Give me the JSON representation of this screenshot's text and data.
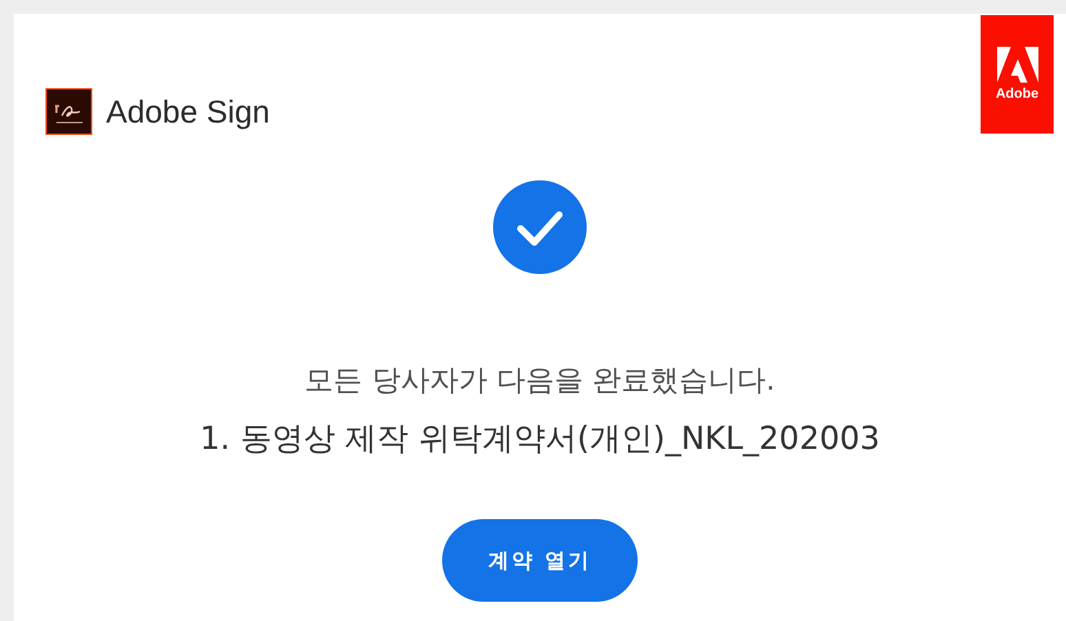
{
  "header": {
    "product": "Adobe Sign",
    "brand_logo_text": "Adobe"
  },
  "message": {
    "status_line": "모든 당사자가 다음을 완료했습니다.",
    "document_title": "1. 동영상 제작 위탁계약서(개인)_NKL_202003"
  },
  "button": {
    "label": "계약 열기"
  }
}
